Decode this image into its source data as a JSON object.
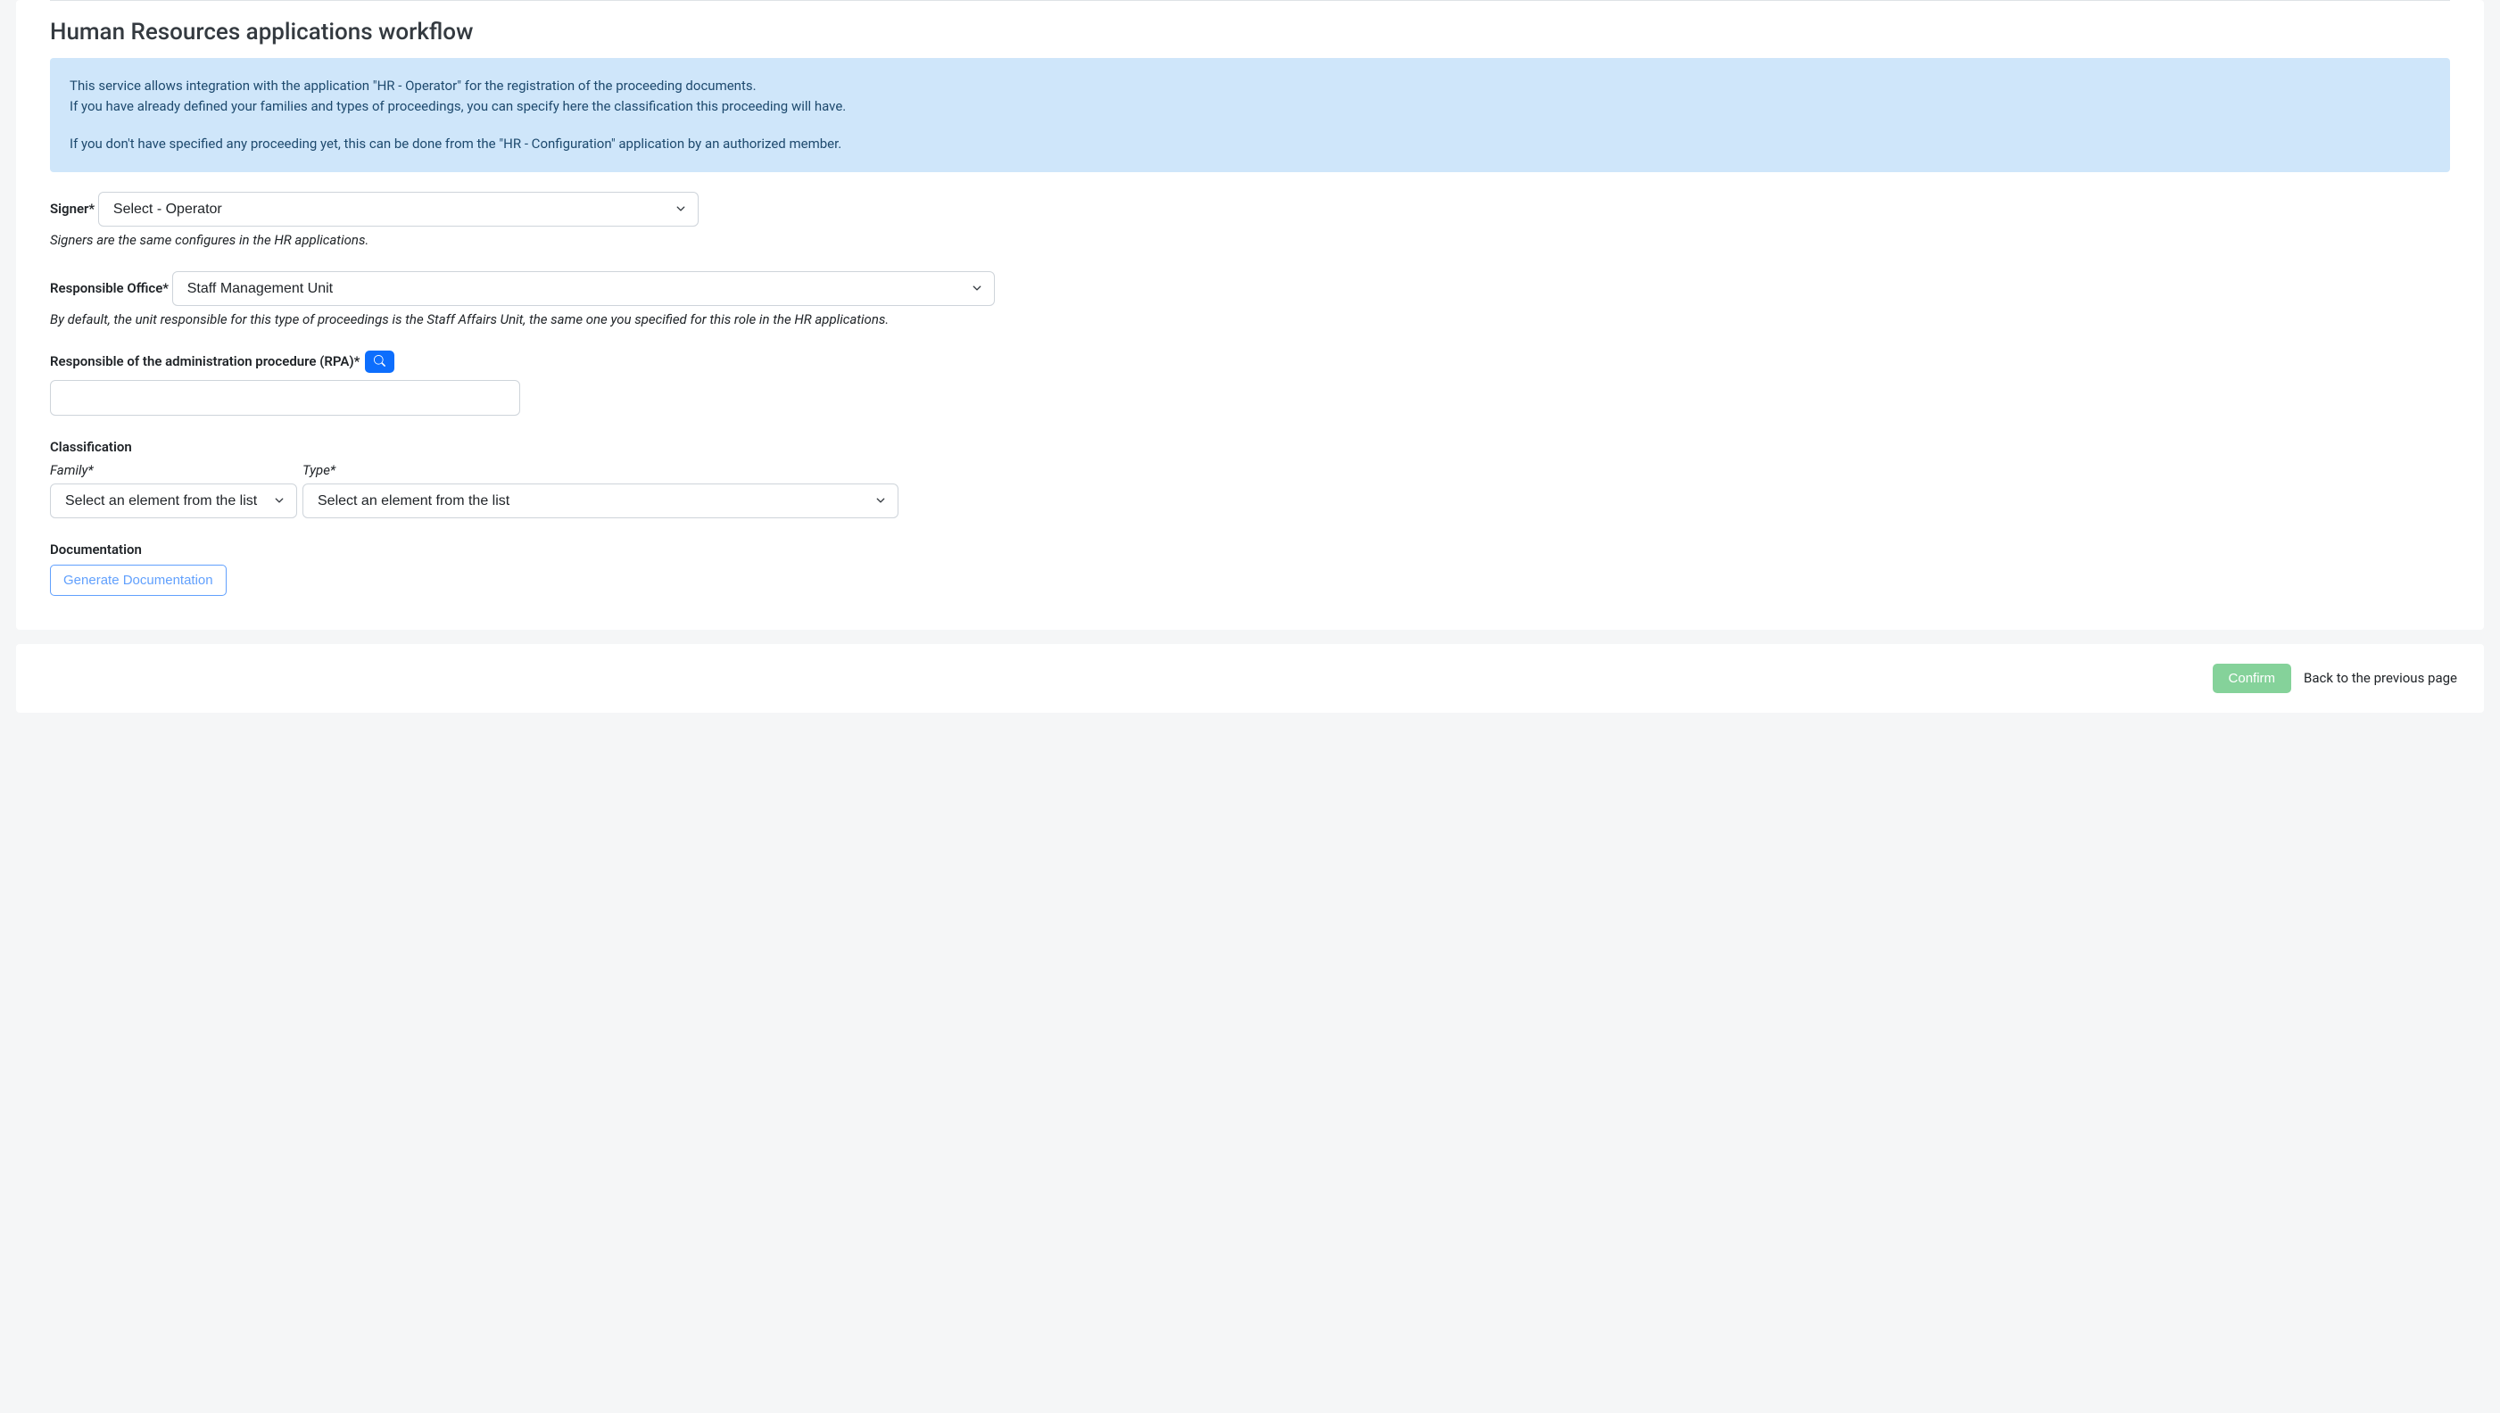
{
  "heading": "Human Resources applications workflow",
  "banner": {
    "line1": "This service allows integration with the application \"HR - Operator\" for the registration of the proceeding documents.",
    "line2": "If you have already defined your families and types of proceedings, you can specify here the classification this proceeding will have.",
    "line3": "If you don't have specified any proceeding yet, this can be done from the \"HR - Configuration\" application by an authorized member."
  },
  "signer": {
    "label": "Signer*",
    "value": "Select - Operator",
    "help": "Signers are the same configures in the HR applications."
  },
  "office": {
    "label": "Responsible Office*",
    "value": "Staff Management Unit",
    "help": "By default, the unit responsible for this type of proceedings is the Staff Affairs Unit, the same one you specified for this role in the HR applications."
  },
  "rpa": {
    "label": "Responsible of the administration procedure (RPA)*",
    "value": ""
  },
  "classification": {
    "label": "Classification",
    "family": {
      "label": "Family*",
      "value": "Select an element from the list"
    },
    "type": {
      "label": "Type*",
      "value": "Select an element from the list"
    }
  },
  "documentation": {
    "label": "Documentation",
    "button": "Generate Documentation"
  },
  "footer": {
    "confirm": "Confirm",
    "back": "Back to the previous page"
  }
}
